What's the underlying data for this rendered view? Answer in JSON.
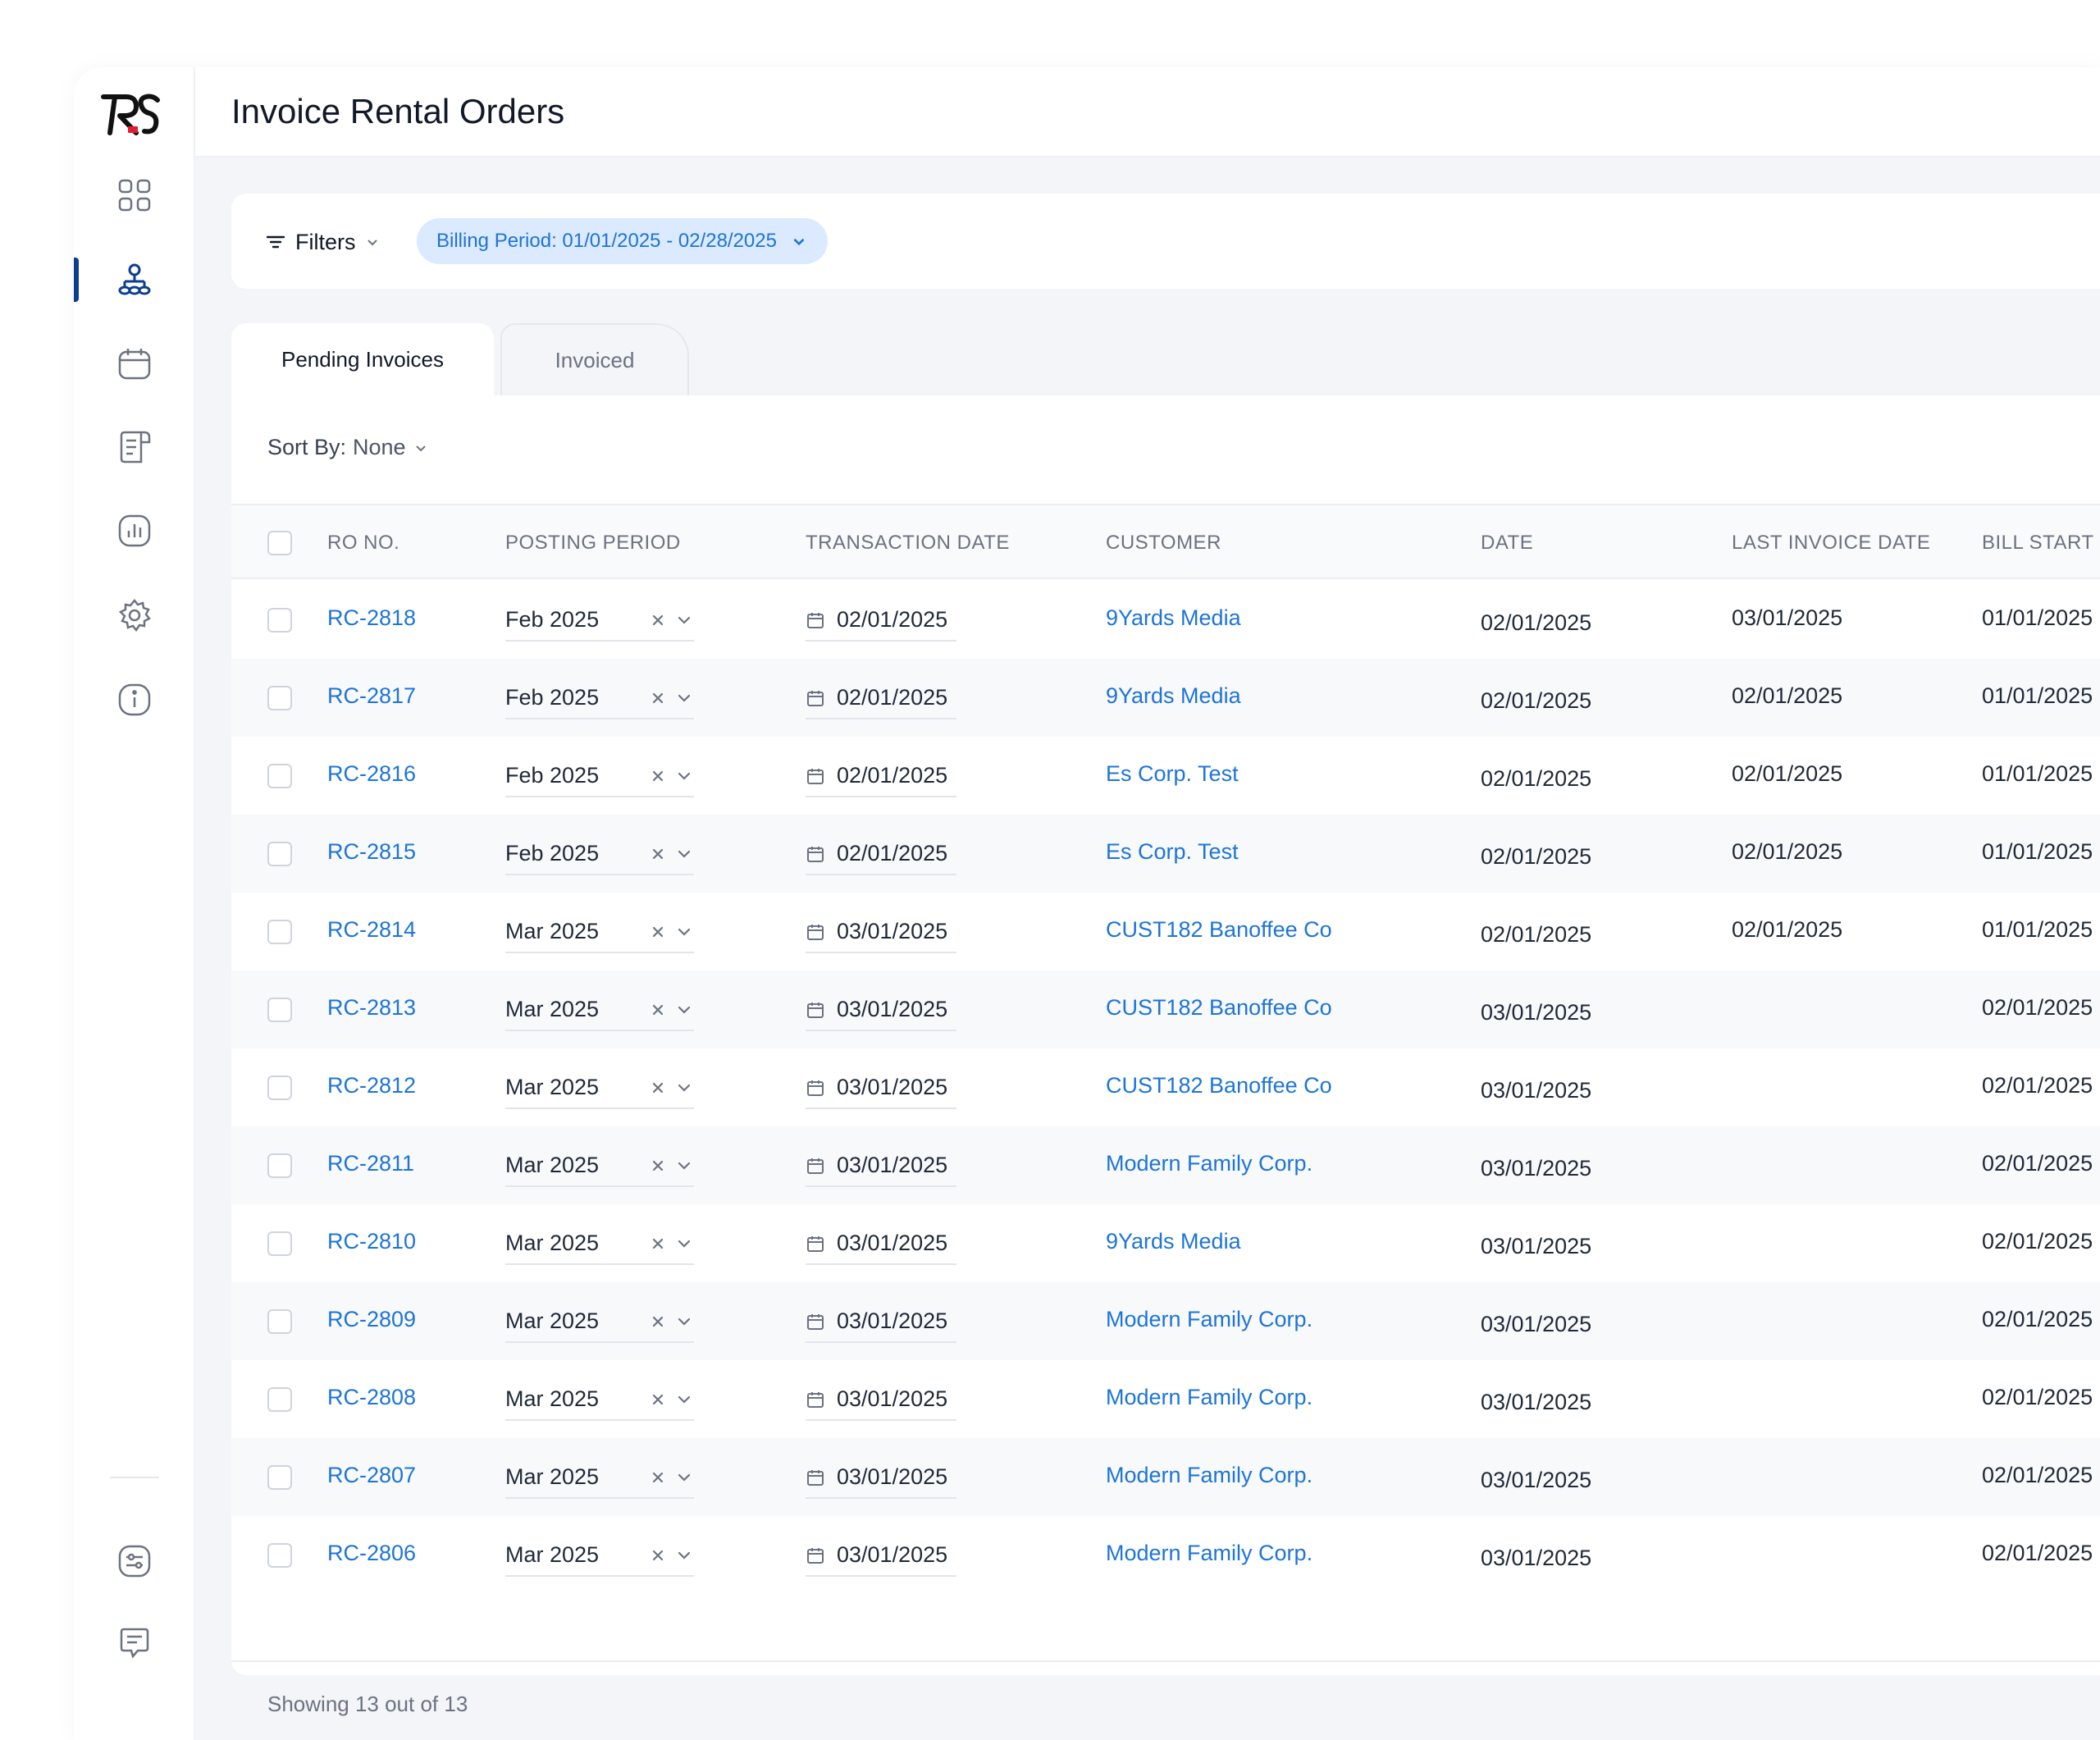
{
  "app": {
    "title": "Invoice Rental Orders",
    "brand": "RS",
    "accent_color": "#1d74d9",
    "nav_active_color": "#0b3d91"
  },
  "sidebar": {
    "items": [
      {
        "icon": "dashboard-grid-icon",
        "active": false
      },
      {
        "icon": "org-hierarchy-icon",
        "active": true
      },
      {
        "icon": "calendar-icon",
        "active": false
      },
      {
        "icon": "document-icon",
        "active": false
      },
      {
        "icon": "reports-chart-icon",
        "active": false
      },
      {
        "icon": "settings-gear-icon",
        "active": false
      },
      {
        "icon": "info-icon",
        "active": false
      }
    ],
    "bottom_items": [
      {
        "icon": "preferences-sliders-icon"
      },
      {
        "icon": "chat-feedback-icon"
      }
    ]
  },
  "filters": {
    "label": "Filters",
    "chip": "Billing Period: 01/01/2025 - 02/28/2025"
  },
  "tabs": [
    {
      "label": "Pending Invoices",
      "active": true
    },
    {
      "label": "Invoiced",
      "active": false
    }
  ],
  "sort": {
    "label": "Sort By:",
    "value": "None"
  },
  "table": {
    "columns": [
      "RO NO.",
      "POSTING PERIOD",
      "TRANSACTION DATE",
      "CUSTOMER",
      "DATE",
      "LAST INVOICE DATE",
      "BILL START"
    ],
    "rows": [
      {
        "ro": "RC-2818",
        "period": "Feb 2025",
        "tx": "02/01/2025",
        "customer": "9Yards Media",
        "date": "02/01/2025",
        "last": "03/01/2025",
        "bill": "01/01/2025"
      },
      {
        "ro": "RC-2817",
        "period": "Feb 2025",
        "tx": "02/01/2025",
        "customer": "9Yards Media",
        "date": "02/01/2025",
        "last": "02/01/2025",
        "bill": "01/01/2025"
      },
      {
        "ro": "RC-2816",
        "period": "Feb 2025",
        "tx": "02/01/2025",
        "customer": "Es Corp. Test",
        "date": "02/01/2025",
        "last": "02/01/2025",
        "bill": "01/01/2025"
      },
      {
        "ro": "RC-2815",
        "period": "Feb 2025",
        "tx": "02/01/2025",
        "customer": "Es Corp. Test",
        "date": "02/01/2025",
        "last": "02/01/2025",
        "bill": "01/01/2025"
      },
      {
        "ro": "RC-2814",
        "period": "Mar 2025",
        "tx": "03/01/2025",
        "customer": "CUST182 Banoffee Co",
        "date": "02/01/2025",
        "last": "02/01/2025",
        "bill": "01/01/2025"
      },
      {
        "ro": "RC-2813",
        "period": "Mar 2025",
        "tx": "03/01/2025",
        "customer": "CUST182 Banoffee Co",
        "date": "03/01/2025",
        "last": "",
        "bill": "02/01/2025"
      },
      {
        "ro": "RC-2812",
        "period": "Mar 2025",
        "tx": "03/01/2025",
        "customer": "CUST182 Banoffee Co",
        "date": "03/01/2025",
        "last": "",
        "bill": "02/01/2025"
      },
      {
        "ro": "RC-2811",
        "period": "Mar 2025",
        "tx": "03/01/2025",
        "customer": "Modern Family Corp.",
        "date": "03/01/2025",
        "last": "",
        "bill": "02/01/2025"
      },
      {
        "ro": "RC-2810",
        "period": "Mar 2025",
        "tx": "03/01/2025",
        "customer": "9Yards Media",
        "date": "03/01/2025",
        "last": "",
        "bill": "02/01/2025"
      },
      {
        "ro": "RC-2809",
        "period": "Mar 2025",
        "tx": "03/01/2025",
        "customer": "Modern Family Corp.",
        "date": "03/01/2025",
        "last": "",
        "bill": "02/01/2025"
      },
      {
        "ro": "RC-2808",
        "period": "Mar 2025",
        "tx": "03/01/2025",
        "customer": "Modern Family Corp.",
        "date": "03/01/2025",
        "last": "",
        "bill": "02/01/2025"
      },
      {
        "ro": "RC-2807",
        "period": "Mar 2025",
        "tx": "03/01/2025",
        "customer": "Modern Family Corp.",
        "date": "03/01/2025",
        "last": "",
        "bill": "02/01/2025"
      },
      {
        "ro": "RC-2806",
        "period": "Mar 2025",
        "tx": "03/01/2025",
        "customer": "Modern Family Corp.",
        "date": "03/01/2025",
        "last": "",
        "bill": "02/01/2025"
      }
    ]
  },
  "footer": {
    "showing": "Showing 13 out of 13"
  }
}
